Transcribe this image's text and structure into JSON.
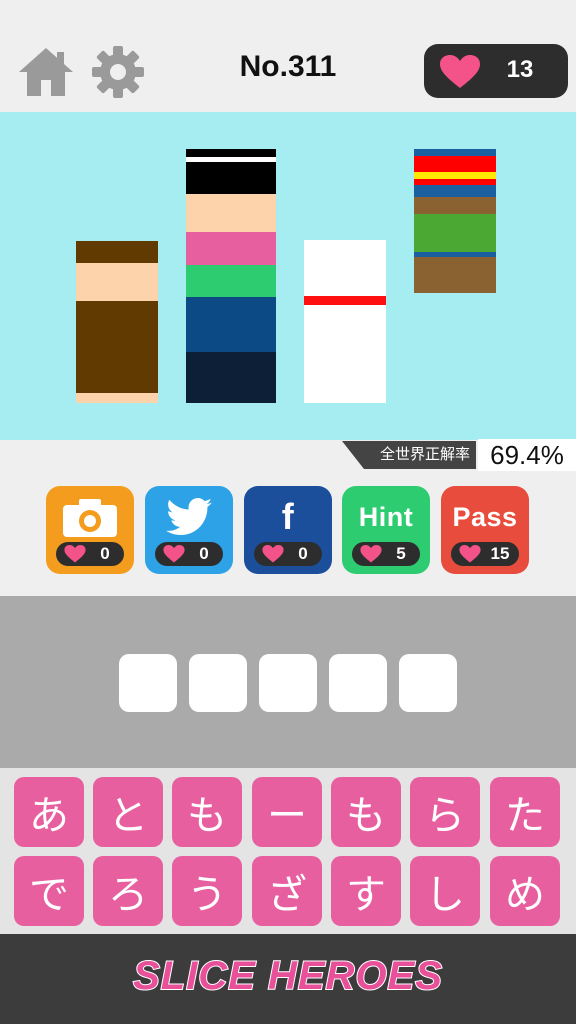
{
  "header": {
    "level": "No.311",
    "hearts": "13",
    "home_icon": "home-icon",
    "settings_icon": "gear-icon"
  },
  "accuracy": {
    "label": "全世界正解率",
    "value": "69.4%"
  },
  "actions": [
    {
      "id": "camera",
      "icon": "camera-icon",
      "label": "",
      "cost": "0",
      "color": "#f39c1e"
    },
    {
      "id": "twitter",
      "icon": "twitter-bird-icon",
      "label": "",
      "cost": "0",
      "color": "#2ea2e6"
    },
    {
      "id": "facebook",
      "icon": "facebook-icon",
      "label": "f",
      "cost": "0",
      "color": "#1b4f9c"
    },
    {
      "id": "hint",
      "icon": "",
      "label": "Hint",
      "cost": "5",
      "color": "#2ecc71"
    },
    {
      "id": "pass",
      "icon": "",
      "label": "Pass",
      "cost": "15",
      "color": "#e74c3c"
    }
  ],
  "answer": {
    "slots": [
      "",
      "",
      "",
      "",
      ""
    ]
  },
  "keyboard": {
    "row1": [
      "あ",
      "と",
      "も",
      "ー",
      "も",
      "ら",
      "た"
    ],
    "row2": [
      "で",
      "ろ",
      "う",
      "ざ",
      "す",
      "し",
      "め"
    ]
  },
  "footer": {
    "logo_text": "SLICE HEROES"
  },
  "colors": {
    "picture_bg": "#a6edf2",
    "heart": "#f4538a",
    "key": "#e85fa0"
  }
}
